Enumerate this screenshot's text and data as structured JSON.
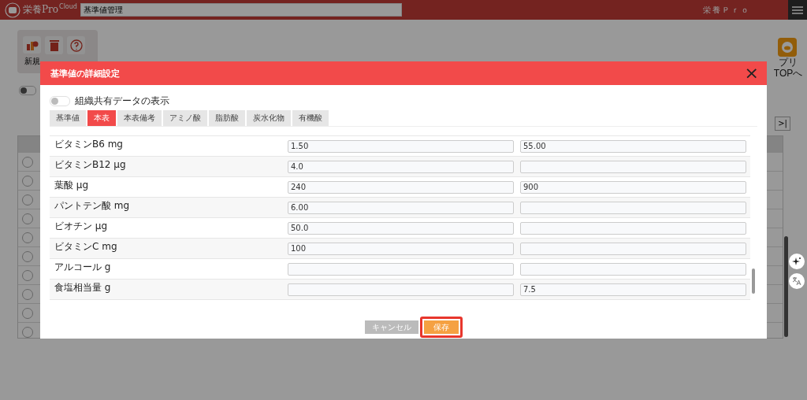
{
  "header": {
    "logo": "栄養Pro",
    "logo_badge": "Cloud",
    "search_value": "基準値管理",
    "app_name": "栄養Ｐｒｏ"
  },
  "toolbar": {
    "new_label": "新規"
  },
  "app_top": {
    "label": "プリTOPへ"
  },
  "pager": {
    "last": ">|"
  },
  "filter_toggle": {
    "on": false
  },
  "background_table": {
    "rows": [
      {
        "selected": false
      },
      {
        "selected": false
      },
      {
        "selected": false
      },
      {
        "selected": false
      },
      {
        "selected": false
      },
      {
        "selected": false
      },
      {
        "selected": false
      },
      {
        "selected": false
      },
      {
        "selected": false
      },
      {
        "selected": false
      }
    ]
  },
  "dialog": {
    "title": "基準値の詳細設定",
    "close": "×",
    "shared_toggle": {
      "label": "組織共有データの表示",
      "on": false
    },
    "tabs": [
      {
        "label": "基準値",
        "selected": false
      },
      {
        "label": "本表",
        "selected": true
      },
      {
        "label": "本表備考",
        "selected": false
      },
      {
        "label": "アミノ酸",
        "selected": false
      },
      {
        "label": "脂肪酸",
        "selected": false
      },
      {
        "label": "炭水化物",
        "selected": false
      },
      {
        "label": "有機酸",
        "selected": false
      }
    ],
    "rows": [
      {
        "label": "ビタミンB6 mg",
        "value_1": "1.50",
        "value_2": "55.00"
      },
      {
        "label": "ビタミンB12 µg",
        "value_1": "4.0",
        "value_2": ""
      },
      {
        "label": "葉酸 µg",
        "value_1": "240",
        "value_2": "900"
      },
      {
        "label": "パントテン酸 mg",
        "value_1": "6.00",
        "value_2": ""
      },
      {
        "label": "ビオチン µg",
        "value_1": "50.0",
        "value_2": ""
      },
      {
        "label": "ビタミンC mg",
        "value_1": "100",
        "value_2": ""
      },
      {
        "label": "アルコール g",
        "value_1": "",
        "value_2": ""
      },
      {
        "label": "食塩相当量 g",
        "value_1": "",
        "value_2": "7.5"
      }
    ],
    "buttons": [
      {
        "label": "キャンセル",
        "kind": "cancel",
        "highlighted": false
      },
      {
        "label": "保存",
        "kind": "save",
        "highlighted": true
      }
    ]
  }
}
